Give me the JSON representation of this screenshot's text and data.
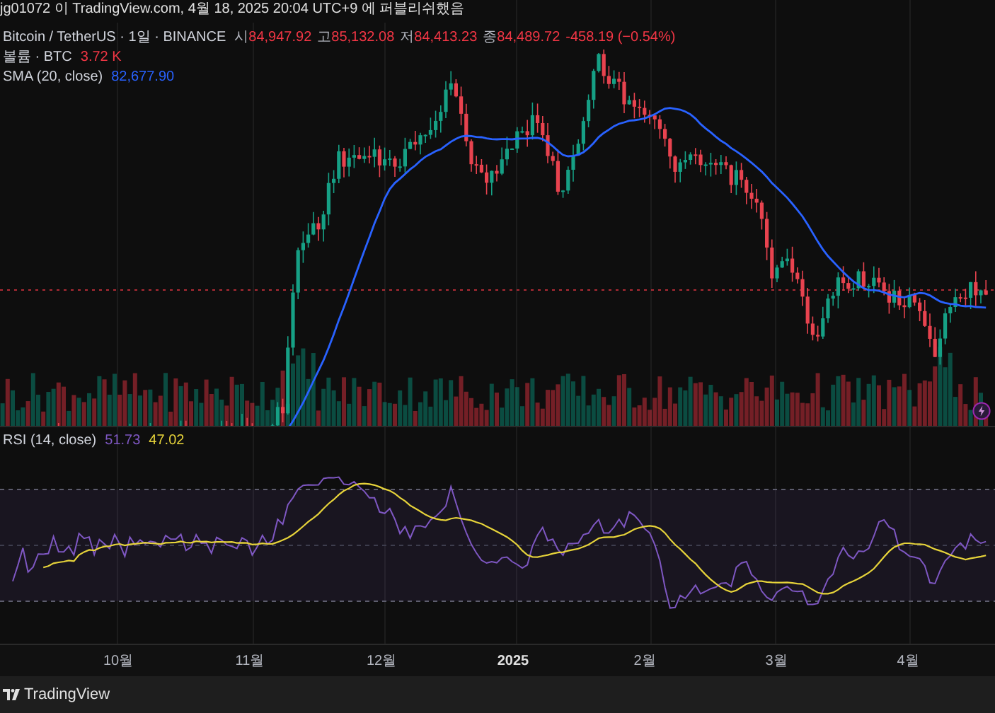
{
  "publish_note": "jg01072 이 TradingView.com, 4월 18, 2025 20:04 UTC+9 에 퍼블리쉬했음",
  "legend": {
    "symbol": "Bitcoin / TetherUS · 1일 · BINANCE",
    "ohlc": [
      {
        "label": "시",
        "value": "84,947.92"
      },
      {
        "label": "고",
        "value": "85,132.08"
      },
      {
        "label": "저",
        "value": "84,413.23"
      },
      {
        "label": "종",
        "value": "84,489.72"
      }
    ],
    "change": "-458.19 (−0.54%)"
  },
  "volume": {
    "label": "볼륨 · BTC",
    "value": "3.72 K"
  },
  "sma": {
    "label": "SMA (20, close)",
    "value": "82,677.90"
  },
  "rsi": {
    "label": "RSI (14, close)",
    "value": "51.73",
    "signal": "47.02"
  },
  "time_axis": [
    {
      "label": "10월",
      "bold": false
    },
    {
      "label": "11월",
      "bold": false
    },
    {
      "label": "12월",
      "bold": false
    },
    {
      "label": "2025",
      "bold": true
    },
    {
      "label": "2월",
      "bold": false
    },
    {
      "label": "3월",
      "bold": false
    },
    {
      "label": "4월",
      "bold": false
    }
  ],
  "footer": {
    "brand": "TradingView"
  }
}
